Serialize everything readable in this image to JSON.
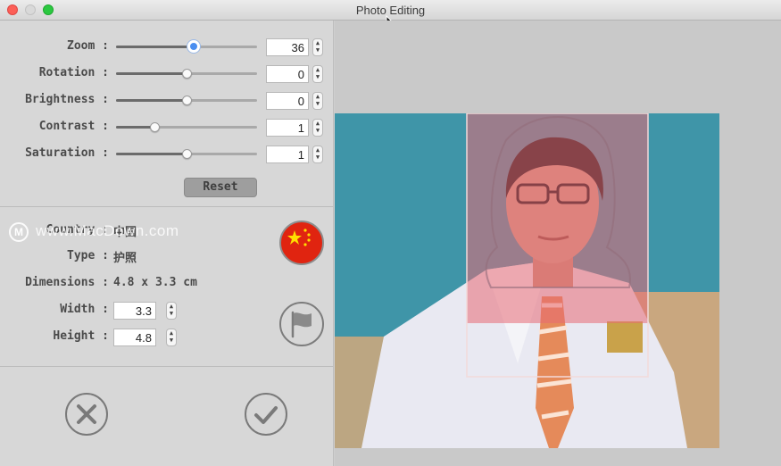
{
  "window": {
    "title": "Photo Editing"
  },
  "adjustments": [
    {
      "label": "Zoom :",
      "value": "36",
      "level": 0.55,
      "active": true
    },
    {
      "label": "Rotation :",
      "value": "0",
      "level": 0.5,
      "active": false
    },
    {
      "label": "Brightness :",
      "value": "0",
      "level": 0.5,
      "active": false
    },
    {
      "label": "Contrast :",
      "value": "1",
      "level": 0.27,
      "active": false
    },
    {
      "label": "Saturation :",
      "value": "1",
      "level": 0.5,
      "active": false
    }
  ],
  "reset_label": "Reset",
  "info": {
    "country_label": "Country :",
    "country_value": "中国",
    "type_label": "Type :",
    "type_value": "护照",
    "dimensions_label": "Dimensions :",
    "dimensions_value": "4.8 x 3.3 cm",
    "width_label": "Width :",
    "width_value": "3.3",
    "height_label": "Height :",
    "height_value": "4.8"
  },
  "watermark": "www.MacDown.com",
  "icons": {
    "flag": "china-flag-icon",
    "custom_flag": "flag-icon",
    "cancel": "cancel-icon",
    "confirm": "checkmark-icon"
  },
  "colors": {
    "teal_background": "#3f95a8",
    "overlay_red": "#e86a74",
    "flag_red": "#e02410"
  }
}
